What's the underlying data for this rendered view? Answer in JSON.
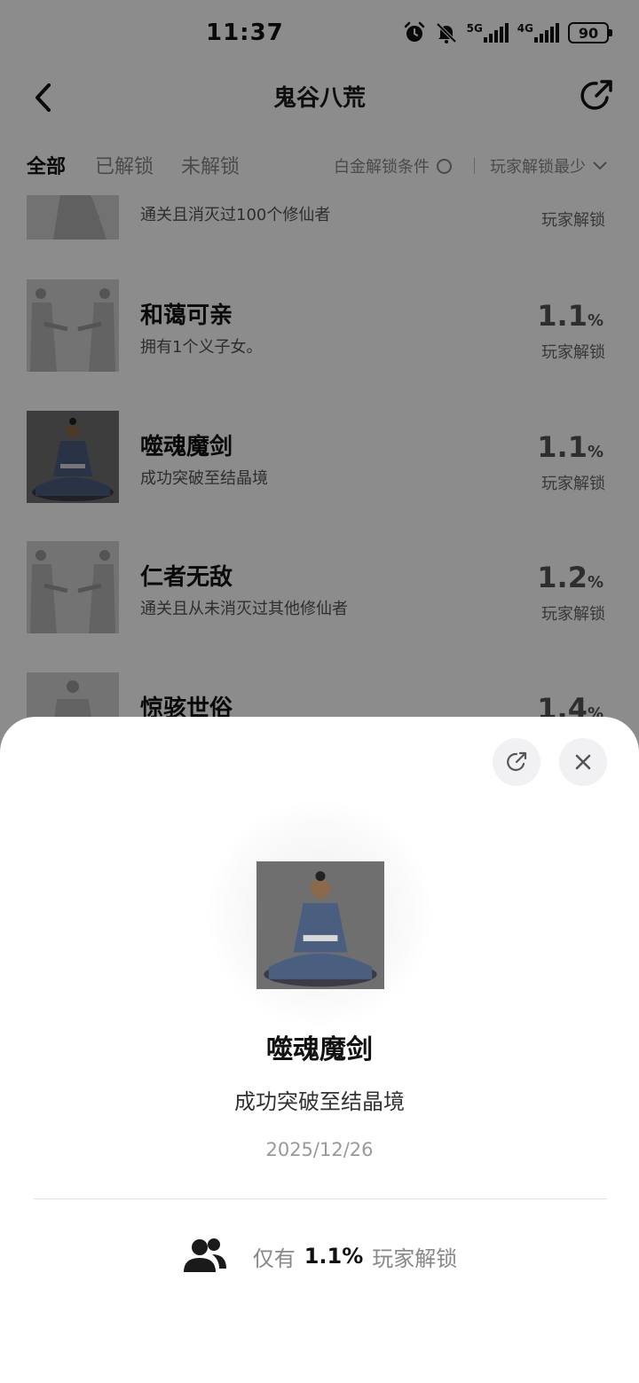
{
  "status_bar": {
    "time": "11:37",
    "network_5g": "5G",
    "network_4g": "4G",
    "battery": "90",
    "icons": [
      "alarm-icon",
      "bell-off-icon"
    ]
  },
  "header": {
    "title": "鬼谷八荒",
    "back_icon": "chevron-left-icon",
    "share_icon": "share-icon"
  },
  "filters": {
    "tabs": [
      {
        "label": "全部",
        "active": true
      },
      {
        "label": "已解锁",
        "active": false
      },
      {
        "label": "未解锁",
        "active": false
      }
    ],
    "platinum_label": "白金解锁条件",
    "sort_label": "玩家解锁最少"
  },
  "achievements": [
    {
      "title": "",
      "desc": "通关且消灭过100个修仙者",
      "pct": "",
      "unit": "",
      "caption": "玩家解锁",
      "unlocked": false
    },
    {
      "title": "和蔼可亲",
      "desc": "拥有1个义子女。",
      "pct": "1.1",
      "unit": "%",
      "caption": "玩家解锁",
      "unlocked": false
    },
    {
      "title": "噬魂魔剑",
      "desc": "成功突破至结晶境",
      "pct": "1.1",
      "unit": "%",
      "caption": "玩家解锁",
      "unlocked": true
    },
    {
      "title": "仁者无敌",
      "desc": "通关且从未消灭过其他修仙者",
      "pct": "1.2",
      "unit": "%",
      "caption": "玩家解锁",
      "unlocked": false
    },
    {
      "title": "惊骇世俗",
      "desc": "",
      "pct": "1.4",
      "unit": "%",
      "caption": "",
      "unlocked": false
    }
  ],
  "sheet": {
    "title": "噬魂魔剑",
    "desc": "成功突破至结晶境",
    "date": "2025/12/26",
    "stat_prefix": "仅有",
    "stat_value": "1.1%",
    "stat_suffix": "玩家解锁",
    "colors": {
      "dim": "#000000",
      "thumb_bg": "#6f6f6f",
      "robe": "#4a5f80"
    }
  }
}
